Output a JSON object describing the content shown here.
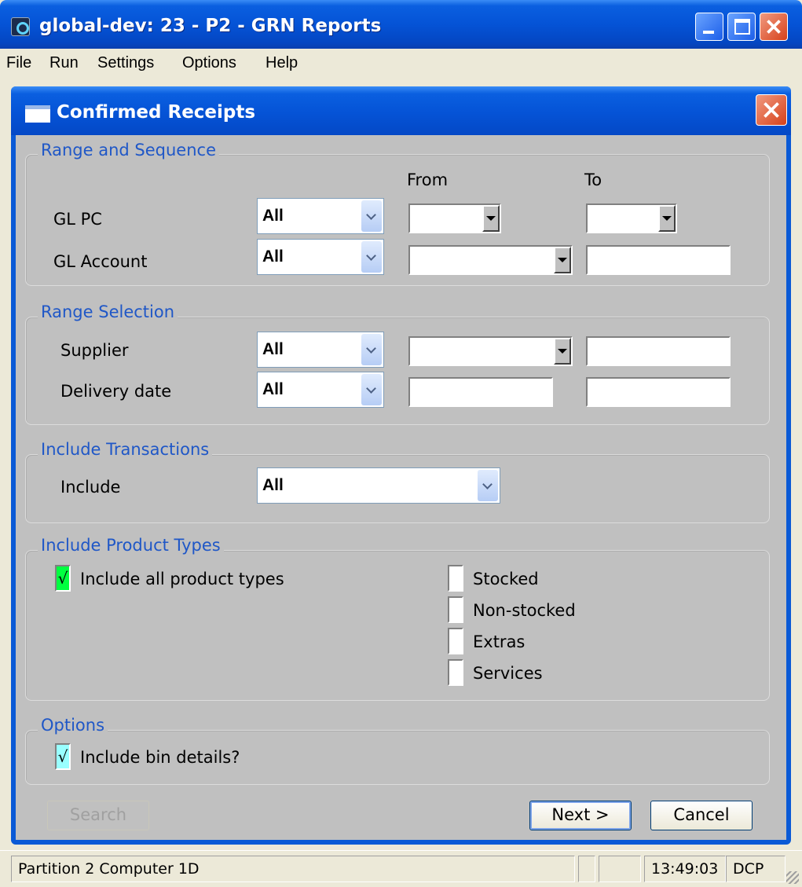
{
  "window": {
    "title": "global-dev: 23 - P2 - GRN Reports"
  },
  "menu": {
    "items": [
      "File",
      "Run",
      "Settings",
      "Options",
      "Help"
    ]
  },
  "dialog": {
    "title": "Confirmed Receipts"
  },
  "range_sequence": {
    "legend": "Range and Sequence",
    "from_header": "From",
    "to_header": "To",
    "gl_pc": {
      "label": "GL PC",
      "selection": "All",
      "from": "",
      "to": ""
    },
    "gl_account": {
      "label": "GL Account",
      "selection": "All",
      "from": "",
      "to": ""
    }
  },
  "range_selection": {
    "legend": "Range Selection",
    "supplier": {
      "label": "Supplier",
      "selection": "All",
      "from": "",
      "to": ""
    },
    "delivery_date": {
      "label": "Delivery date",
      "selection": "All",
      "from": "",
      "to": ""
    }
  },
  "include_transactions": {
    "legend": "Include Transactions",
    "label": "Include",
    "selection": "All"
  },
  "product_types": {
    "legend": "Include Product Types",
    "include_all": {
      "label": "Include all product types",
      "checked": true,
      "mark": "√"
    },
    "stocked": {
      "label": "Stocked",
      "checked": false
    },
    "non_stocked": {
      "label": "Non-stocked",
      "checked": false
    },
    "extras": {
      "label": "Extras",
      "checked": false
    },
    "services": {
      "label": "Services",
      "checked": false
    }
  },
  "options": {
    "legend": "Options",
    "bin_details": {
      "label": "Include bin details?",
      "checked": true,
      "mark": "√"
    }
  },
  "buttons": {
    "search": "Search",
    "next": "Next >",
    "cancel": "Cancel"
  },
  "status": {
    "partition": "Partition 2 Computer 1D",
    "time": "13:49:03",
    "user": "DCP"
  },
  "colors": {
    "titlebar": "#0553d6",
    "legend_text": "#1f57c7",
    "include_all_check_bg": "#00ff40",
    "bin_details_check_bg": "#99ffff"
  }
}
